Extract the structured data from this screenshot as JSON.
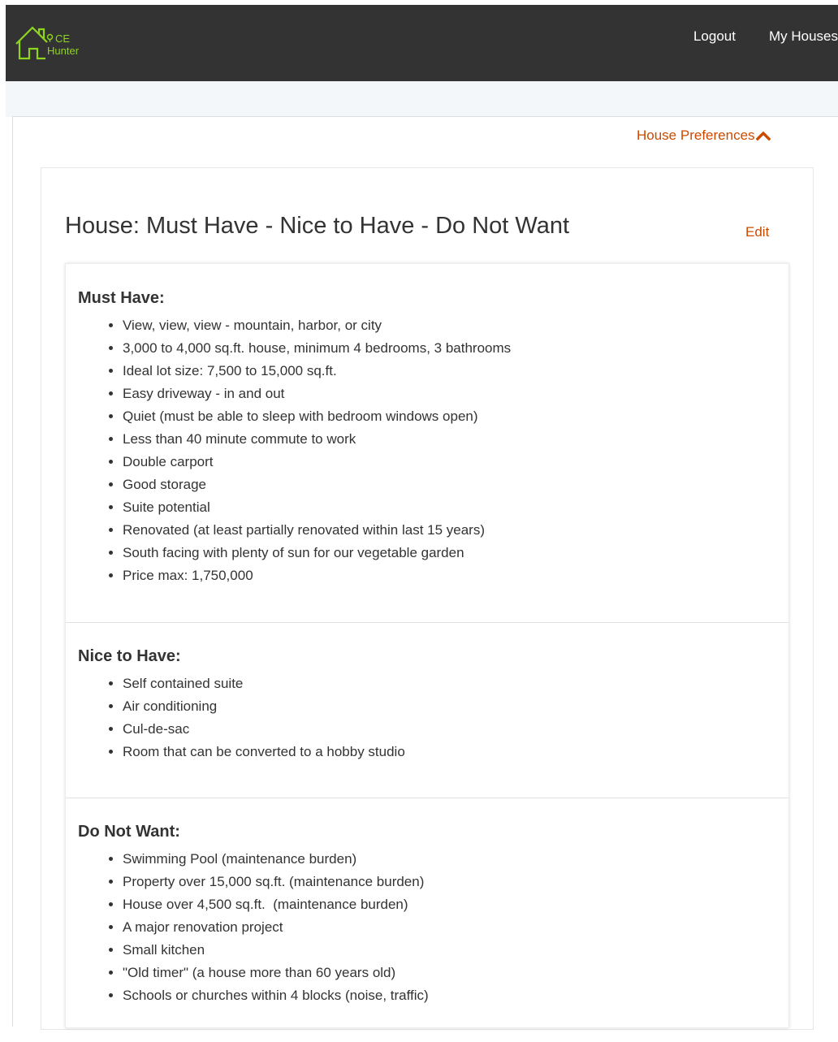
{
  "header": {
    "logo": {
      "line1": "CE",
      "line2": "Hunter"
    },
    "nav": {
      "logout": "Logout",
      "my_houses": "My Houses"
    }
  },
  "preferences_toggle": {
    "label": "House Preferences",
    "icon": "chevron-up-icon"
  },
  "page": {
    "title": "House: Must Have - Nice to Have - Do Not Want",
    "edit_label": "Edit"
  },
  "sections": {
    "must_have": {
      "heading": "Must Have:",
      "items": [
        "View, view, view - mountain, harbor, or city",
        "3,000 to 4,000 sq.ft. house, minimum 4 bedrooms, 3 bathrooms",
        "Ideal lot size: 7,500 to 15,000 sq.ft.",
        "Easy driveway - in and out",
        "Quiet (must be able to sleep with bedroom windows open)",
        "Less than 40 minute commute to work",
        "Double carport",
        "Good storage",
        "Suite potential",
        "Renovated (at least partially renovated within last 15 years)",
        "South facing with plenty of sun for our vegetable garden",
        "Price max: 1,750,000"
      ]
    },
    "nice_to_have": {
      "heading": "Nice to Have:",
      "items": [
        "Self contained suite",
        "Air conditioning",
        "Cul-de-sac",
        "Room that can be converted to a hobby studio"
      ]
    },
    "do_not_want": {
      "heading": "Do Not Want:",
      "items": [
        "Swimming Pool (maintenance burden)",
        "Property over 15,000 sq.ft. (maintenance burden)",
        "House over 4,500 sq.ft.  (maintenance burden)",
        "A major renovation project",
        "Small kitchen",
        "\"Old timer\" (a house more than 60 years old)",
        "Schools or churches within 4 blocks (noise, traffic)"
      ]
    }
  },
  "colors": {
    "topbar": "#333333",
    "accent": "#cc4a00",
    "logo_green": "#8ed61e",
    "text": "#333333"
  }
}
